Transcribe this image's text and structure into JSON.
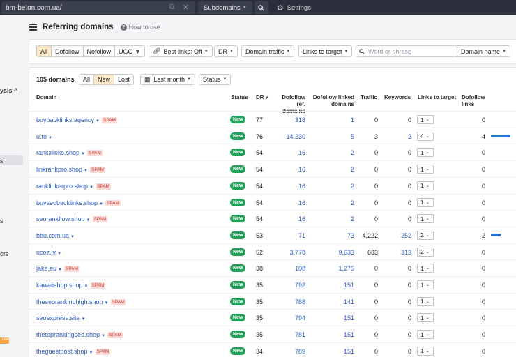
{
  "topbar": {
    "url": "bm-beton.com.ua/",
    "mode": "Subdomains",
    "settings_label": "Settings"
  },
  "sidebar": {
    "fragments": [
      "ysis ^",
      "s",
      "s",
      "ors"
    ],
    "new_badge": "New"
  },
  "header": {
    "title": "Referring domains",
    "how_to": "How to use"
  },
  "filters": {
    "type_tabs": [
      "All",
      "Dofollow",
      "Nofollow",
      "UGC"
    ],
    "best_links": "Best links: Off",
    "dr": "DR",
    "domain_traffic": "Domain traffic",
    "links_to_target": "Links to target",
    "search_placeholder": "Word or phrase",
    "search_scope": "Domain name"
  },
  "summary": {
    "count": "105 domains",
    "tabs": [
      "All",
      "New",
      "Lost"
    ],
    "active_tab": "New",
    "period": "Last month",
    "status": "Status"
  },
  "table": {
    "headers": {
      "domain": "Domain",
      "status": "Status",
      "dr": "DR",
      "dofollow_ref_domains": [
        "Dofollow ref.",
        "domains"
      ],
      "dofollow_linked_domains": [
        "Dofollow linked",
        "domains"
      ],
      "traffic": "Traffic",
      "keywords": "Keywords",
      "links_to_target": "Links to target",
      "dofollow_links": [
        "Dofollow",
        "links"
      ]
    },
    "rows": [
      {
        "domain": "buybacklinks.agency",
        "spam": "SPAM",
        "status": "New",
        "dr": "77",
        "ref": "318",
        "linked": "1",
        "traffic": "0",
        "keywords": "0",
        "links": "1",
        "dofollow": "0",
        "bar": 0
      },
      {
        "domain": "u.to",
        "spam": "",
        "status": "New",
        "dr": "76",
        "ref": "14,230",
        "linked": "5",
        "traffic": "3",
        "keywords": "2",
        "links": "4",
        "dofollow": "4",
        "bar": 1.0
      },
      {
        "domain": "rankxlinks.shop",
        "spam": "SPAM",
        "status": "New",
        "dr": "54",
        "ref": "16",
        "linked": "2",
        "traffic": "0",
        "keywords": "0",
        "links": "1",
        "dofollow": "0",
        "bar": 0
      },
      {
        "domain": "linkrankpro.shop",
        "spam": "SPAM",
        "status": "New",
        "dr": "54",
        "ref": "16",
        "linked": "2",
        "traffic": "0",
        "keywords": "0",
        "links": "1",
        "dofollow": "0",
        "bar": 0
      },
      {
        "domain": "ranklinkerpro.shop",
        "spam": "SPAM",
        "status": "New",
        "dr": "54",
        "ref": "16",
        "linked": "2",
        "traffic": "0",
        "keywords": "0",
        "links": "1",
        "dofollow": "0",
        "bar": 0
      },
      {
        "domain": "buyseobacklinks.shop",
        "spam": "SPAM",
        "status": "New",
        "dr": "54",
        "ref": "16",
        "linked": "2",
        "traffic": "0",
        "keywords": "0",
        "links": "1",
        "dofollow": "0",
        "bar": 0
      },
      {
        "domain": "seorankflow.shop",
        "spam": "SPAM",
        "status": "New",
        "dr": "54",
        "ref": "16",
        "linked": "2",
        "traffic": "0",
        "keywords": "0",
        "links": "1",
        "dofollow": "0",
        "bar": 0
      },
      {
        "domain": "bbu.com.ua",
        "spam": "",
        "status": "New",
        "dr": "53",
        "ref": "71",
        "linked": "73",
        "traffic": "4,222",
        "keywords": "252",
        "links": "2",
        "dofollow": "2",
        "bar": 0.5
      },
      {
        "domain": "ucoz.lv",
        "spam": "",
        "status": "New",
        "dr": "52",
        "ref": "3,778",
        "linked": "9,633",
        "traffic": "633",
        "keywords": "313",
        "links": "2",
        "dofollow": "0",
        "bar": 0
      },
      {
        "domain": "jake.eu",
        "spam": "SPAM",
        "status": "New",
        "dr": "38",
        "ref": "108",
        "linked": "1,275",
        "traffic": "0",
        "keywords": "0",
        "links": "1",
        "dofollow": "0",
        "bar": 0
      },
      {
        "domain": "kawaiishop.shop",
        "spam": "SPAM",
        "status": "New",
        "dr": "35",
        "ref": "792",
        "linked": "151",
        "traffic": "0",
        "keywords": "0",
        "links": "1",
        "dofollow": "0",
        "bar": 0
      },
      {
        "domain": "theseorankinghigh.shop",
        "spam": "SPAM",
        "status": "New",
        "dr": "35",
        "ref": "788",
        "linked": "141",
        "traffic": "0",
        "keywords": "0",
        "links": "1",
        "dofollow": "0",
        "bar": 0
      },
      {
        "domain": "seoexpress.site",
        "spam": "",
        "status": "New",
        "dr": "35",
        "ref": "794",
        "linked": "151",
        "traffic": "0",
        "keywords": "0",
        "links": "1",
        "dofollow": "0",
        "bar": 0
      },
      {
        "domain": "thetoprankingseo.shop",
        "spam": "SPAM",
        "status": "New",
        "dr": "35",
        "ref": "781",
        "linked": "151",
        "traffic": "0",
        "keywords": "0",
        "links": "1",
        "dofollow": "0",
        "bar": 0
      },
      {
        "domain": "theguestpost.shop",
        "spam": "SPAM",
        "status": "New",
        "dr": "34",
        "ref": "789",
        "linked": "151",
        "traffic": "0",
        "keywords": "0",
        "links": "1",
        "dofollow": "0",
        "bar": 0
      }
    ]
  },
  "colors": {
    "topbar": "#2b2f3b",
    "accent_active": "#fde9c8",
    "link": "#2c5cc5",
    "new_badge": "#23a15a",
    "spam_bg": "#fbd9d6",
    "bar": "#2e6fd0"
  }
}
